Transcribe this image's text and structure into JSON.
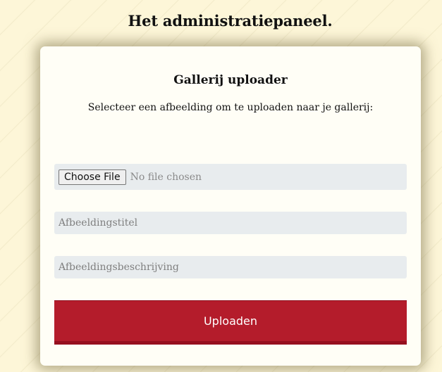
{
  "page": {
    "title": "Het administratiepaneel."
  },
  "uploader": {
    "title": "Gallerij uploader",
    "subtitle": "Selecteer een afbeelding om te uploaden naar je gallerij:",
    "file_input": {
      "button_label": "Choose File",
      "status": "No file chosen"
    },
    "image_title": {
      "value": "",
      "placeholder": "Afbeeldingstitel"
    },
    "image_description": {
      "value": "",
      "placeholder": "Afbeeldingsbeschrijving"
    },
    "submit_label": "Uploaden"
  },
  "colors": {
    "background": "#fdf6d8",
    "card": "#fffef6",
    "field": "#e8ecee",
    "accent": "#b41c2b"
  }
}
